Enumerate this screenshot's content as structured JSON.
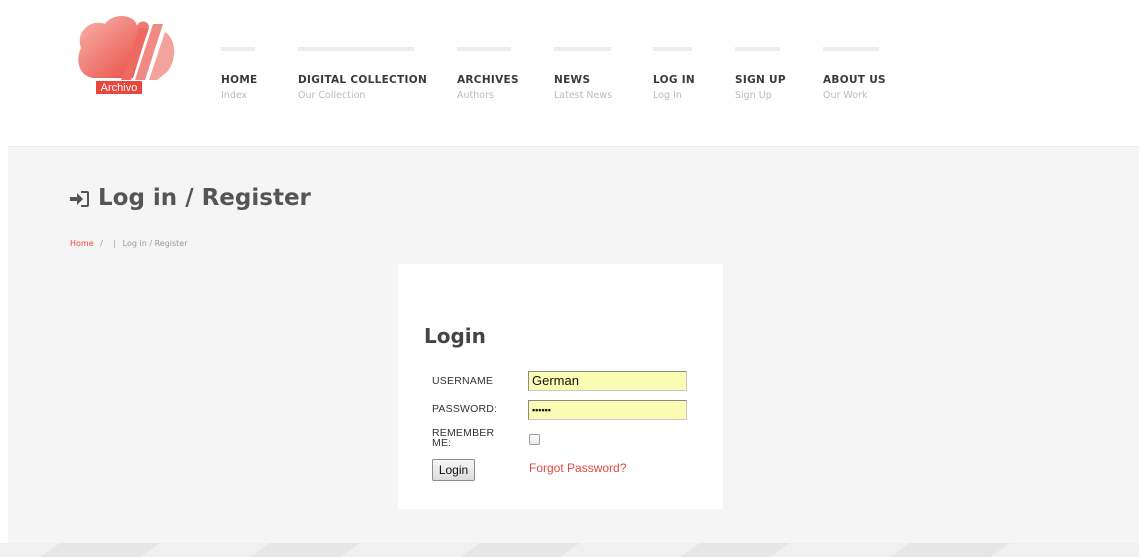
{
  "logo": {
    "label": "Archivo",
    "brand_color": "#e8473e"
  },
  "nav": [
    {
      "title": "HOME",
      "subtitle": "Index"
    },
    {
      "title": "DIGITAL COLLECTION",
      "subtitle": "Our Collection"
    },
    {
      "title": "ARCHIVES",
      "subtitle": "Authors"
    },
    {
      "title": "NEWS",
      "subtitle": "Latest News"
    },
    {
      "title": "LOG IN",
      "subtitle": "Log In"
    },
    {
      "title": "SIGN UP",
      "subtitle": "Sign Up"
    },
    {
      "title": "ABOUT US",
      "subtitle": "Our Work"
    }
  ],
  "page": {
    "title": "Log in / Register",
    "title_icon": "sign-in-icon",
    "breadcrumb": {
      "home": "Home",
      "separator": "/",
      "pipe": "|",
      "current": "Log in / Register"
    }
  },
  "login": {
    "heading": "Login",
    "username_label": "USERNAME",
    "username_value": "German",
    "password_label": "PASSWORD:",
    "password_value": "••••••",
    "remember_label": "REMEMBER ME:",
    "remember_checked": false,
    "submit_label": "Login",
    "forgot_label": "Forgot Password?"
  }
}
